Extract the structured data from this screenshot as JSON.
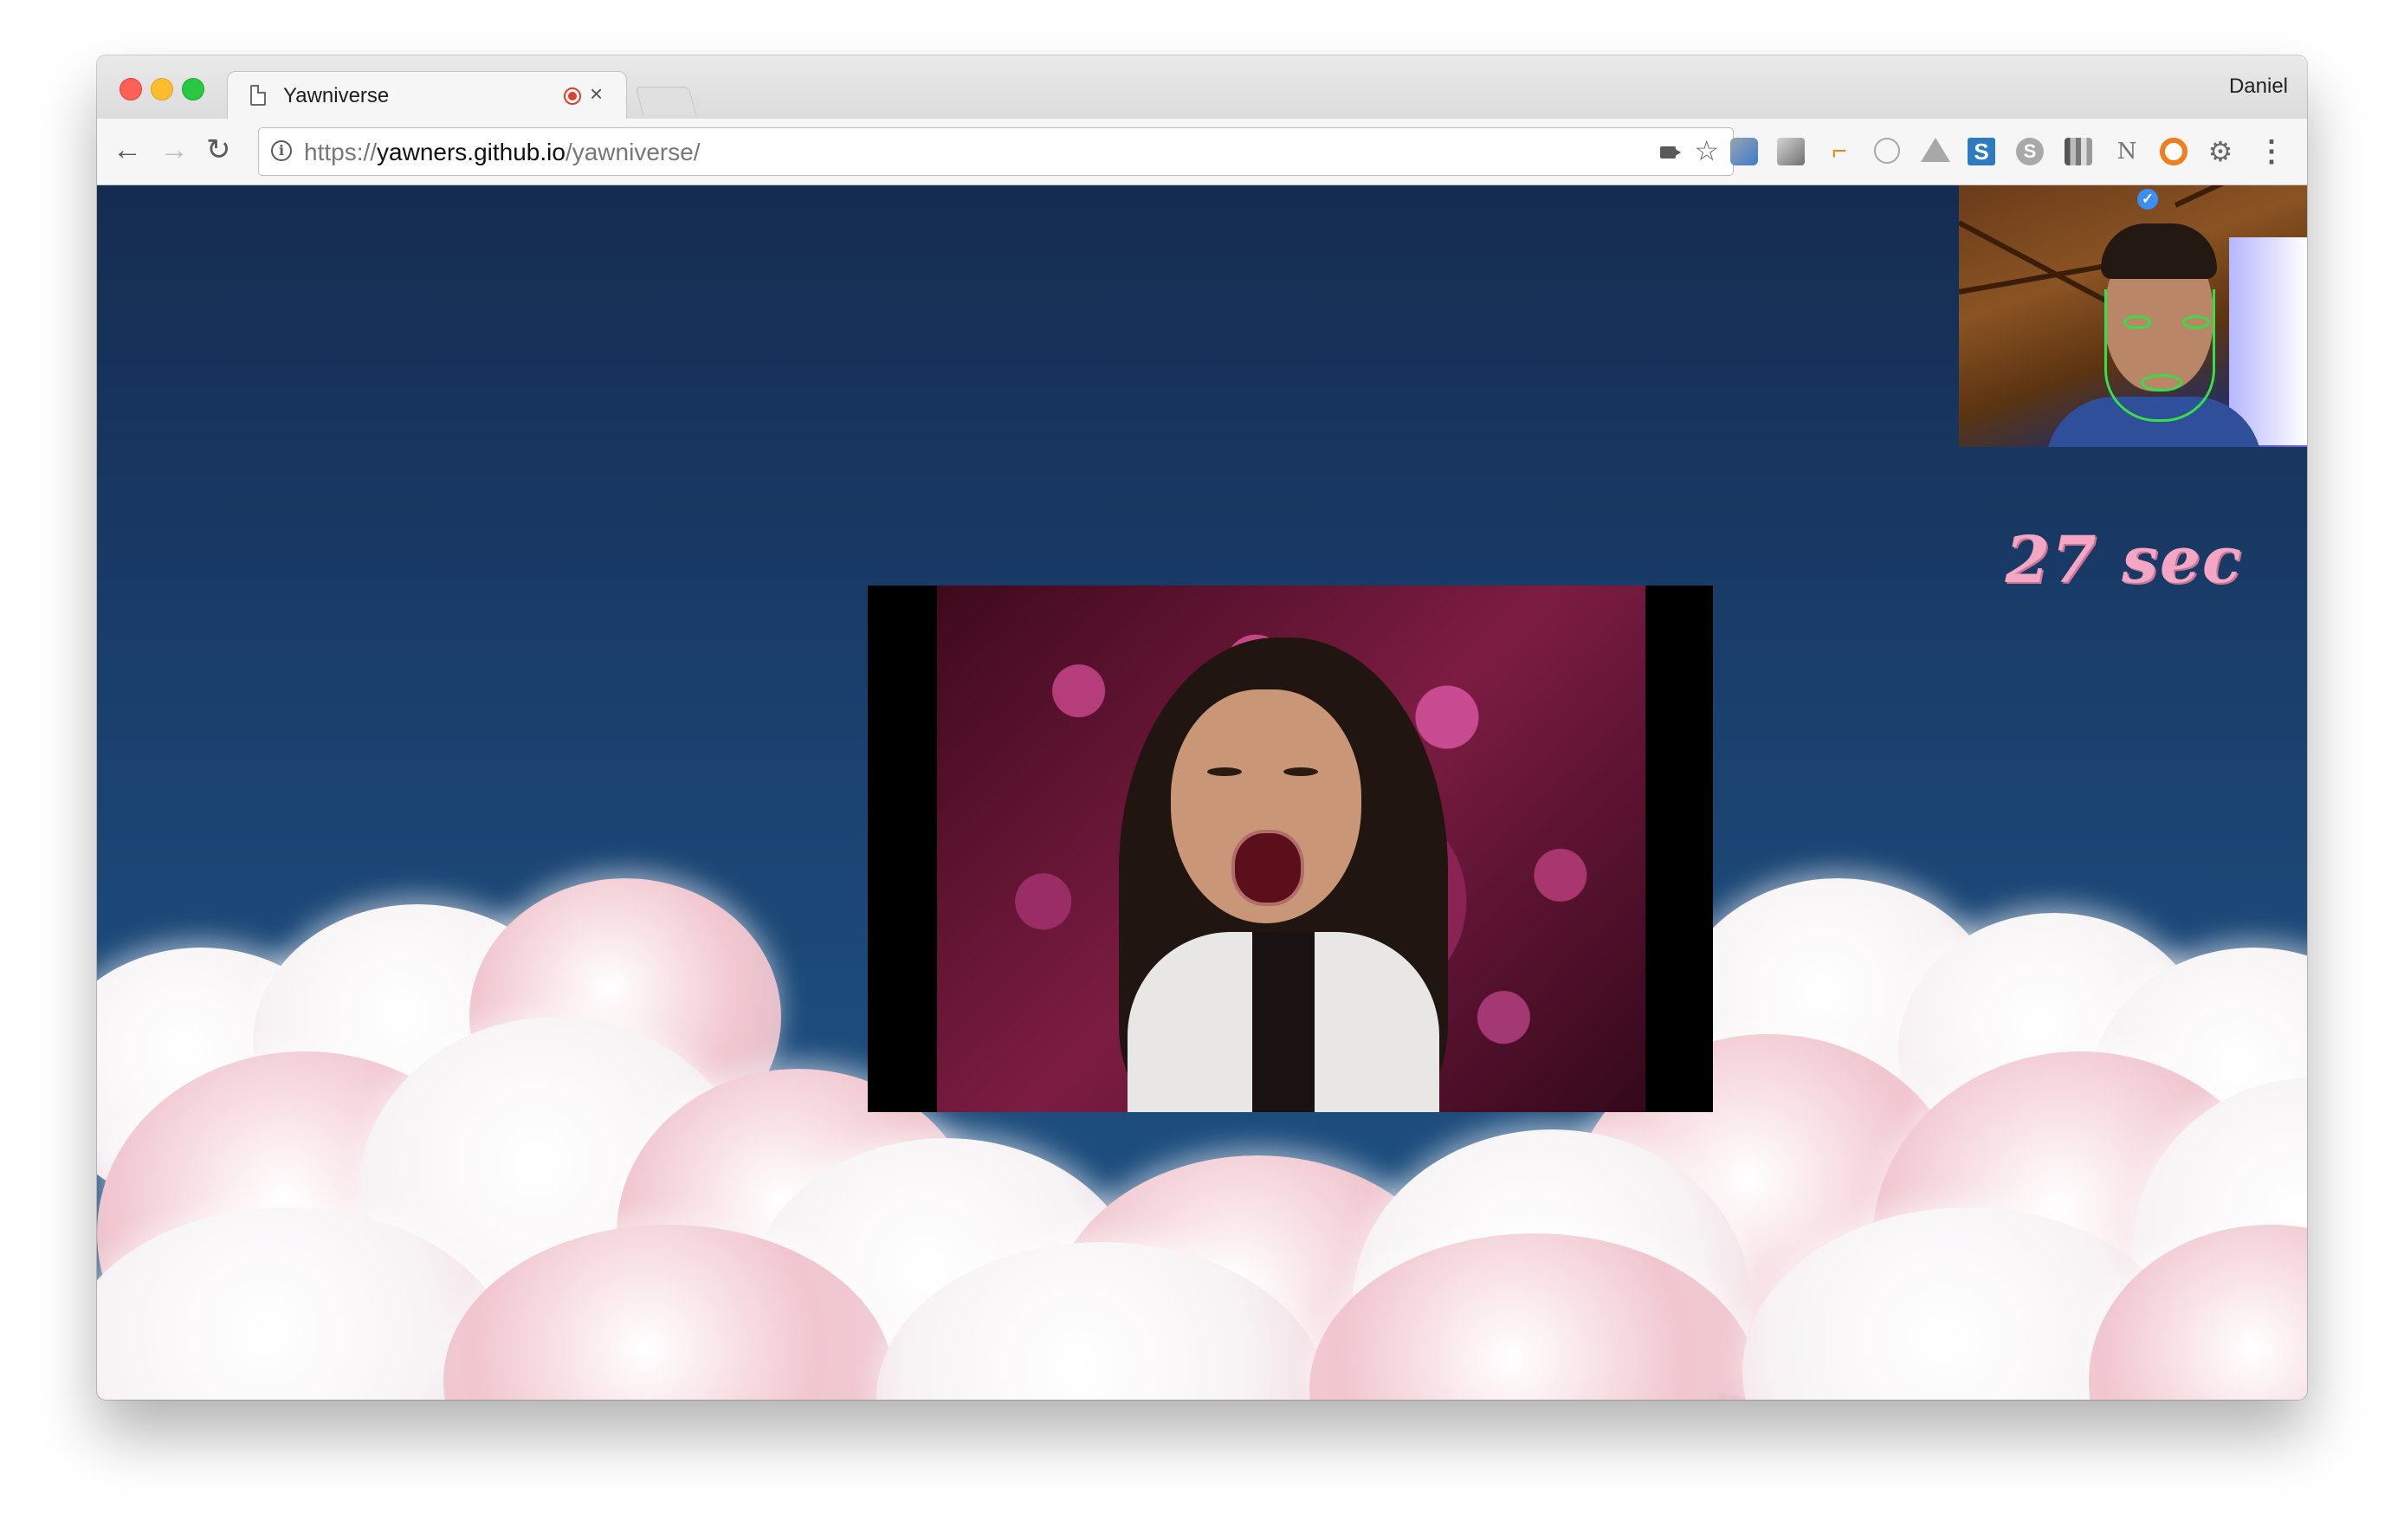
{
  "browser": {
    "tab": {
      "title": "Yawniverse"
    },
    "profile_name": "Daniel",
    "address": {
      "protocol": "https://",
      "host": "yawners.github.io",
      "path": "/yawniverse/"
    },
    "extensions": [
      "eyedropper-extension-icon",
      "gradient-extension-icon",
      "ruler-extension-icon",
      "circle-extension-icon",
      "drive-extension-icon",
      "s-extension-icon",
      "skype-extension-icon",
      "barcode-extension-icon",
      "notion-extension-icon",
      "lifebuoy-extension-icon",
      "gear-extension-icon"
    ]
  },
  "page": {
    "timer_text": "27 sec",
    "timer_color": "#f4a7c2",
    "webcam": {
      "face_tracking": true,
      "mesh_color": "#34e045"
    },
    "media": {
      "description_icon": "yawn-gif"
    }
  },
  "colors": {
    "sky_top": "#152c50",
    "sky_bottom": "#1e4f80",
    "cloud_pink": "#f1c6cf",
    "cloud_white": "#f7f3f5"
  }
}
